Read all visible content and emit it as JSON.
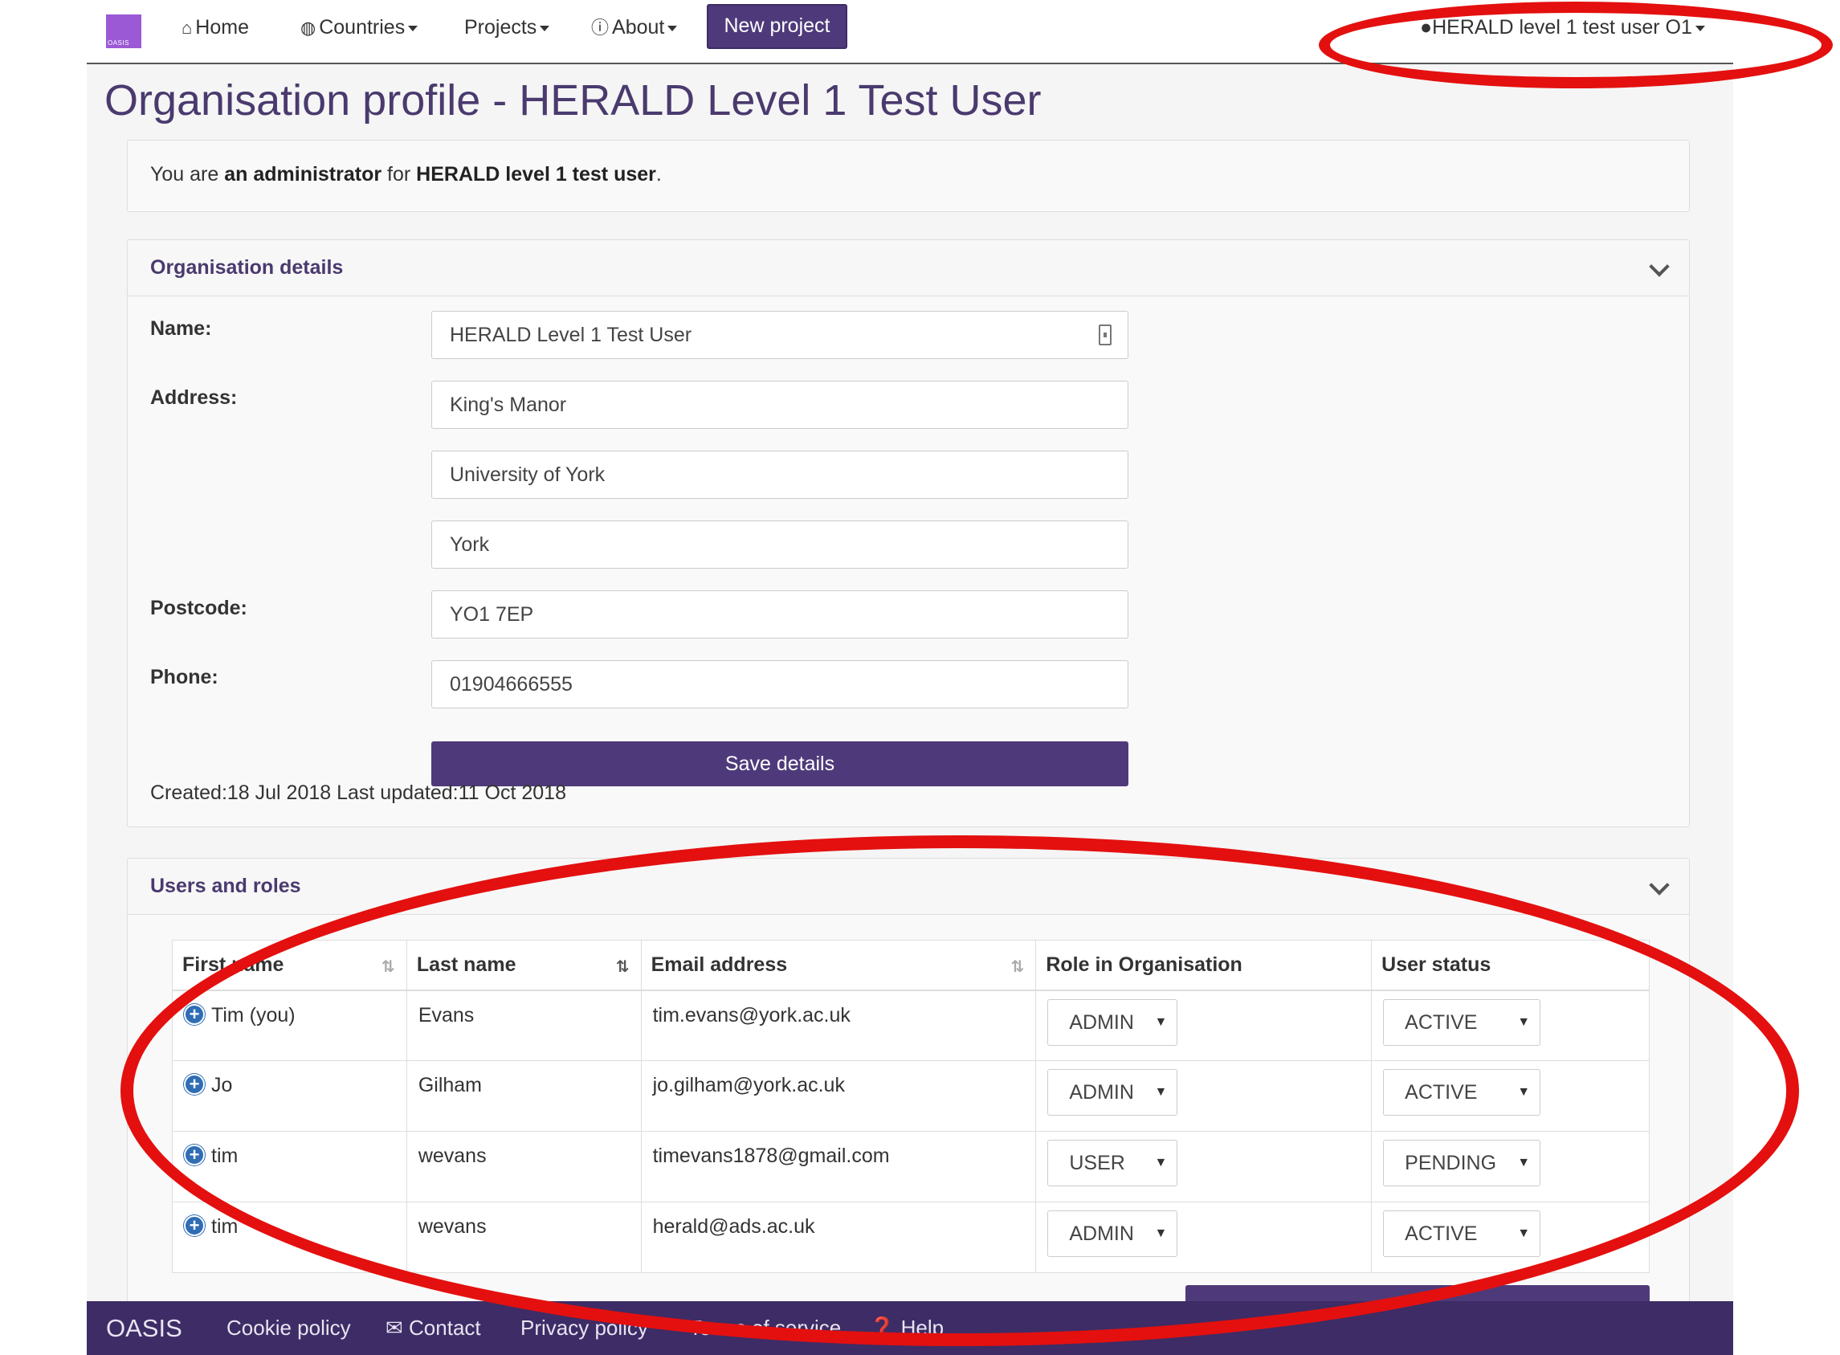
{
  "nav": {
    "logo_text": "OASIS",
    "home": "Home",
    "countries": "Countries",
    "projects": "Projects",
    "about": "About",
    "new_project": "New project",
    "user": "HERALD level 1 test user O1"
  },
  "page": {
    "title": "Organisation profile - HERALD Level 1 Test User"
  },
  "info": {
    "prefix": "You are ",
    "role": "an administrator",
    "middle": " for ",
    "org": "HERALD level 1 test user",
    "suffix": "."
  },
  "details": {
    "heading": "Organisation details",
    "name_label": "Name:",
    "name_value": "HERALD Level 1 Test User",
    "address_label": "Address:",
    "address_line1": "King's Manor",
    "address_line2": "University of York",
    "address_line3": "York",
    "postcode_label": "Postcode:",
    "postcode_value": "YO1 7EP",
    "phone_label": "Phone:",
    "phone_value": "01904666555",
    "save_label": "Save details",
    "dates": "Created:18 Jul 2018 Last updated:11 Oct 2018"
  },
  "users": {
    "heading": "Users and roles",
    "columns": [
      "First name",
      "Last name",
      "Email address",
      "Role in Organisation",
      "User status"
    ],
    "rows": [
      {
        "first": "Tim (you)",
        "last": "Evans",
        "email": "tim.evans@york.ac.uk",
        "role": "ADMIN",
        "status": "ACTIVE"
      },
      {
        "first": "Jo",
        "last": "Gilham",
        "email": "jo.gilham@york.ac.uk",
        "role": "ADMIN",
        "status": "ACTIVE"
      },
      {
        "first": "tim",
        "last": "wevans",
        "email": "timevans1878@gmail.com",
        "role": "USER",
        "status": "PENDING"
      },
      {
        "first": "tim",
        "last": "wevans",
        "email": "herald@ads.ac.uk",
        "role": "ADMIN",
        "status": "ACTIVE"
      }
    ]
  },
  "footer": {
    "brand": "OASIS",
    "cookie": "Cookie policy",
    "contact": "Contact",
    "privacy": "Privacy policy",
    "terms": "Terms of service",
    "help": "Help"
  },
  "colors": {
    "brand_purple": "#4e3a7a",
    "footer_purple": "#3d2c66",
    "annotation_red": "#e3100f"
  }
}
